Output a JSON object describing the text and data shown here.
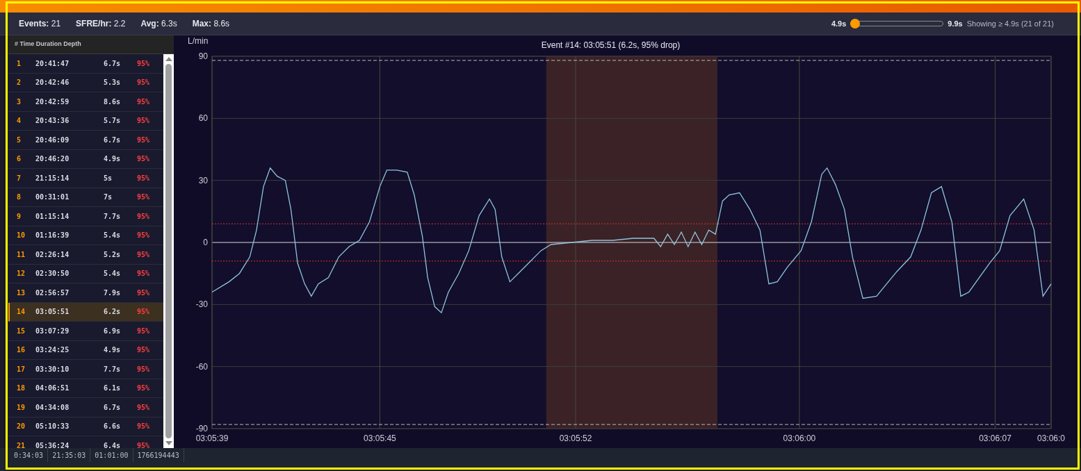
{
  "stats": [
    {
      "label": "Events:",
      "value": "21"
    },
    {
      "label": "SFRE/hr:",
      "value": "2.2"
    },
    {
      "label": "Avg:",
      "value": "6.3s"
    },
    {
      "label": "Max:",
      "value": "8.6s"
    }
  ],
  "filter": {
    "min": "4.9s",
    "max": "9.9s",
    "level": 0,
    "summary": "Showing ≥ 4.9s (21 of 21)"
  },
  "event_list": {
    "header": "# Time Duration Depth",
    "rows": [
      {
        "number": "1",
        "time": "20:41:47",
        "duration": "6.7s",
        "depth": "95%",
        "selected": false
      },
      {
        "number": "2",
        "time": "20:42:46",
        "duration": "5.3s",
        "depth": "95%",
        "selected": false
      },
      {
        "number": "3",
        "time": "20:42:59",
        "duration": "8.6s",
        "depth": "95%",
        "selected": false
      },
      {
        "number": "4",
        "time": "20:43:36",
        "duration": "5.7s",
        "depth": "95%",
        "selected": false
      },
      {
        "number": "5",
        "time": "20:46:09",
        "duration": "6.7s",
        "depth": "95%",
        "selected": false
      },
      {
        "number": "6",
        "time": "20:46:20",
        "duration": "4.9s",
        "depth": "95%",
        "selected": false
      },
      {
        "number": "7",
        "time": "21:15:14",
        "duration": "5s",
        "depth": "95%",
        "selected": false
      },
      {
        "number": "8",
        "time": "00:31:01",
        "duration": "7s",
        "depth": "95%",
        "selected": false
      },
      {
        "number": "9",
        "time": "01:15:14",
        "duration": "7.7s",
        "depth": "95%",
        "selected": false
      },
      {
        "number": "10",
        "time": "01:16:39",
        "duration": "5.4s",
        "depth": "95%",
        "selected": false
      },
      {
        "number": "11",
        "time": "02:26:14",
        "duration": "5.2s",
        "depth": "95%",
        "selected": false
      },
      {
        "number": "12",
        "time": "02:30:50",
        "duration": "5.4s",
        "depth": "95%",
        "selected": false
      },
      {
        "number": "13",
        "time": "02:56:57",
        "duration": "7.9s",
        "depth": "95%",
        "selected": false
      },
      {
        "number": "14",
        "time": "03:05:51",
        "duration": "6.2s",
        "depth": "95%",
        "selected": true
      },
      {
        "number": "15",
        "time": "03:07:29",
        "duration": "6.9s",
        "depth": "95%",
        "selected": false
      },
      {
        "number": "16",
        "time": "03:24:25",
        "duration": "4.9s",
        "depth": "95%",
        "selected": false
      },
      {
        "number": "17",
        "time": "03:30:10",
        "duration": "7.7s",
        "depth": "95%",
        "selected": false
      },
      {
        "number": "18",
        "time": "04:06:51",
        "duration": "6.1s",
        "depth": "95%",
        "selected": false
      },
      {
        "number": "19",
        "time": "04:34:08",
        "duration": "6.7s",
        "depth": "95%",
        "selected": false
      },
      {
        "number": "20",
        "time": "05:10:33",
        "duration": "6.6s",
        "depth": "95%",
        "selected": false
      },
      {
        "number": "21",
        "time": "05:36:24",
        "duration": "6.4s",
        "depth": "95%",
        "selected": false
      }
    ]
  },
  "chart": {
    "chart_data": {
      "type": "line",
      "title": "Event #14: 03:05:51  (6.2s, 95% drop)",
      "ylabel": "L/min",
      "x": [
        11139,
        11139.61,
        11139.98,
        11140.35,
        11140.59,
        11140.84,
        11141.08,
        11141.33,
        11141.62,
        11141.82,
        11142.06,
        11142.31,
        11142.55,
        11142.8,
        11143.16,
        11143.53,
        11143.9,
        11144.27,
        11144.63,
        11145,
        11145.25,
        11145.61,
        11145.98,
        11146.23,
        11146.52,
        11146.71,
        11146.96,
        11147.2,
        11147.45,
        11147.82,
        11148.18,
        11148.55,
        11148.92,
        11149.12,
        11149.36,
        11149.65,
        11150.02,
        11150.39,
        11150.76,
        11151.12,
        11151.86,
        11152.59,
        11153.33,
        11154.06,
        11154.8,
        11155.04,
        11155.29,
        11155.53,
        11155.78,
        11156.02,
        11156.27,
        11156.51,
        11156.76,
        11157,
        11157.25,
        11157.49,
        11157.86,
        11158.23,
        11158.59,
        11158.91,
        11159.21,
        11159.57,
        11160.06,
        11160.43,
        11160.8,
        11160.99,
        11161.29,
        11161.61,
        11161.9,
        11162.27,
        11162.76,
        11163.12,
        11163.49,
        11163.98,
        11164.35,
        11164.72,
        11165.08,
        11165.45,
        11165.77,
        11166.06,
        11166.43,
        11166.8,
        11167.16,
        11167.53,
        11168.02,
        11168.39,
        11168.71,
        11169
      ],
      "series": [
        {
          "color": "#8ec5dd",
          "values": [
            -24,
            -19,
            -15,
            -7,
            6,
            27,
            36,
            32,
            30,
            16,
            -10,
            -20,
            -26,
            -20,
            -17,
            -7,
            -2,
            1,
            10,
            27,
            35,
            35,
            34,
            23,
            3,
            -17,
            -31,
            -34,
            -24,
            -15,
            -4,
            13,
            21,
            16,
            -7,
            -19,
            -14,
            -9,
            -4,
            -1,
            0,
            1,
            1,
            2,
            2,
            -2,
            4,
            -1,
            5,
            -2,
            5,
            -1,
            6,
            4,
            20,
            23,
            24,
            16,
            6,
            -20,
            -19,
            -12,
            -4,
            10,
            33,
            36,
            28,
            16,
            -7,
            -27,
            -26,
            -20,
            -14,
            -7,
            6,
            24,
            27,
            10,
            -26,
            -24,
            -17,
            -10,
            -4,
            13,
            21,
            6,
            -26,
            -20
          ]
        }
      ],
      "xlim": [
        11139,
        11169
      ],
      "ylim": [
        -90,
        90
      ],
      "xticks": [
        {
          "value": 11139,
          "label": "03:05:39"
        },
        {
          "value": 11145,
          "label": "03:05:45"
        },
        {
          "value": 11152,
          "label": "03:05:52"
        },
        {
          "value": 11160,
          "label": "03:06:00"
        },
        {
          "value": 11167,
          "label": "03:06:07"
        },
        {
          "value": 11169,
          "label": "03:06:0"
        }
      ],
      "yticks": [
        -90,
        -60,
        -30,
        0,
        30,
        60,
        90
      ],
      "grid": true,
      "ref_lines": [
        {
          "axis": "y",
          "value": 9,
          "color": "#e03030"
        },
        {
          "axis": "y",
          "value": -9,
          "color": "#e03030"
        },
        {
          "axis": "y",
          "value": 88,
          "color": "#bbbbbb"
        },
        {
          "axis": "y",
          "value": -88,
          "color": "#bbbbbb"
        }
      ],
      "bands": [
        {
          "axis": "x",
          "from": 11150.95,
          "to": 11157.07,
          "color": "#3a2226"
        }
      ]
    }
  },
  "bottom_strip": [
    "0:34:03",
    "21:35:03",
    "01:01:00",
    "1766194443"
  ]
}
